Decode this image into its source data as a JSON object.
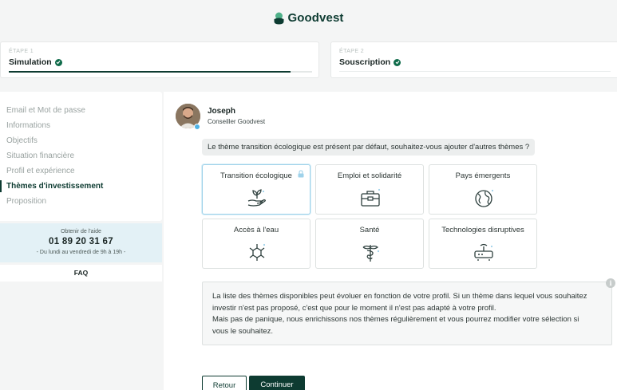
{
  "brand": {
    "name": "Goodvest",
    "color": "#0d3b31"
  },
  "steps": [
    {
      "small": "ÉTAPE 1",
      "title": "Simulation",
      "progress": 0.93
    },
    {
      "small": "ÉTAPE 2",
      "title": "Souscription"
    }
  ],
  "sidebar": {
    "items": [
      "Email et Mot de passe",
      "Informations",
      "Objectifs",
      "Situation financière",
      "Profil et expérience",
      "Thèmes d'investissement",
      "Proposition"
    ],
    "active_index": 5
  },
  "help": {
    "label": "Obtenir de l'aide",
    "phone": "01 89 20 31 67",
    "hours": "- Du lundi au vendredi de 9h à 19h -"
  },
  "faq": "FAQ",
  "advisor": {
    "name": "Joseph",
    "role": "Conseiller Goodvest"
  },
  "question": "Le thème transition écologique est présent par défaut, souhaitez-vous ajouter d'autres thèmes ?",
  "themes": [
    {
      "label": "Transition écologique",
      "icon": "plant-hand-icon",
      "selected": true,
      "locked": true
    },
    {
      "label": "Emploi et solidarité",
      "icon": "briefcase-icon",
      "selected": false
    },
    {
      "label": "Pays émergents",
      "icon": "globe-icon",
      "selected": false
    },
    {
      "label": "Accès à l'eau",
      "icon": "water-molecule-icon",
      "selected": false
    },
    {
      "label": "Santé",
      "icon": "caduceus-icon",
      "selected": false
    },
    {
      "label": "Technologies disruptives",
      "icon": "router-icon",
      "selected": false
    }
  ],
  "info": {
    "line1": "La liste des thèmes disponibles peut évoluer en fonction de votre profil. Si un thème dans lequel vous souhaitez",
    "line2": "investir n'est pas proposé, c'est que pour le moment il n'est pas adapté à votre profil.",
    "line3": "Mais pas de panique, nous enrichissons nos thèmes régulièrement et vous pourrez modifier votre sélection si",
    "line4": "vous le souhaitez.",
    "icon_glyph": "i"
  },
  "buttons": {
    "back": "Retour",
    "next": "Continuer"
  }
}
